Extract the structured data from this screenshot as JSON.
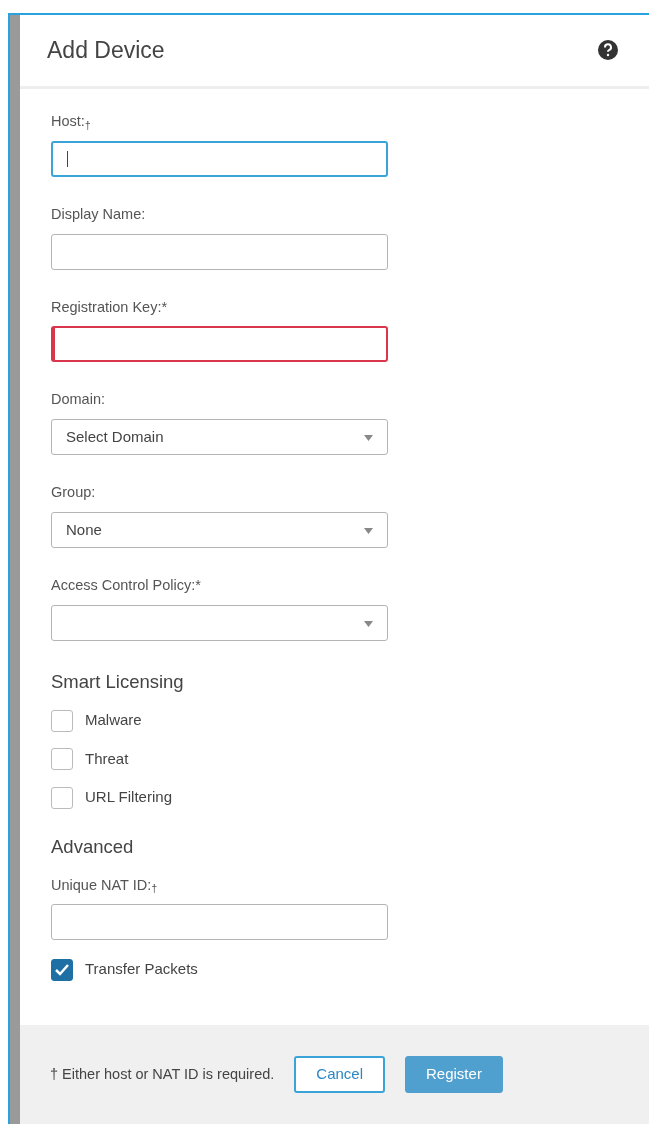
{
  "dialog": {
    "title": "Add Device"
  },
  "fields": [
    {
      "kind": "text",
      "label": "Host:$_{†}$",
      "focused": true,
      "invalid": false
    },
    {
      "kind": "text",
      "label": "Display Name:",
      "focused": false,
      "invalid": false
    },
    {
      "kind": "text",
      "label": "Registration Key:*",
      "focused": false,
      "invalid": true
    },
    {
      "kind": "select",
      "label": "Domain:",
      "value": "Select Domain",
      "focused": false,
      "invalid": false
    },
    {
      "kind": "select",
      "label": "Group:",
      "value": "None",
      "focused": false,
      "invalid": false
    },
    {
      "kind": "select",
      "label": "Access Control Policy:*",
      "focused": false,
      "invalid": false
    }
  ],
  "smart_licensing": {
    "heading": "Smart Licensing",
    "options": [
      {
        "label": "Malware",
        "checked": false
      },
      {
        "label": "Threat",
        "checked": false
      },
      {
        "label": "URL Filtering",
        "checked": false
      }
    ]
  },
  "advanced": {
    "heading": "Advanced",
    "fields": [
      {
        "kind": "text",
        "label": "Unique NAT ID:$_{†}$",
        "focused": false,
        "invalid": false
      }
    ],
    "options": [
      {
        "label": "Transfer Packets",
        "checked": true
      }
    ]
  },
  "footer": {
    "note": "† Either host or NAT ID is required.",
    "buttons": [
      {
        "label": "Cancel",
        "kind": "secondary",
        "disabled": false
      },
      {
        "label": "Register",
        "kind": "primary",
        "disabled": true
      }
    ]
  }
}
